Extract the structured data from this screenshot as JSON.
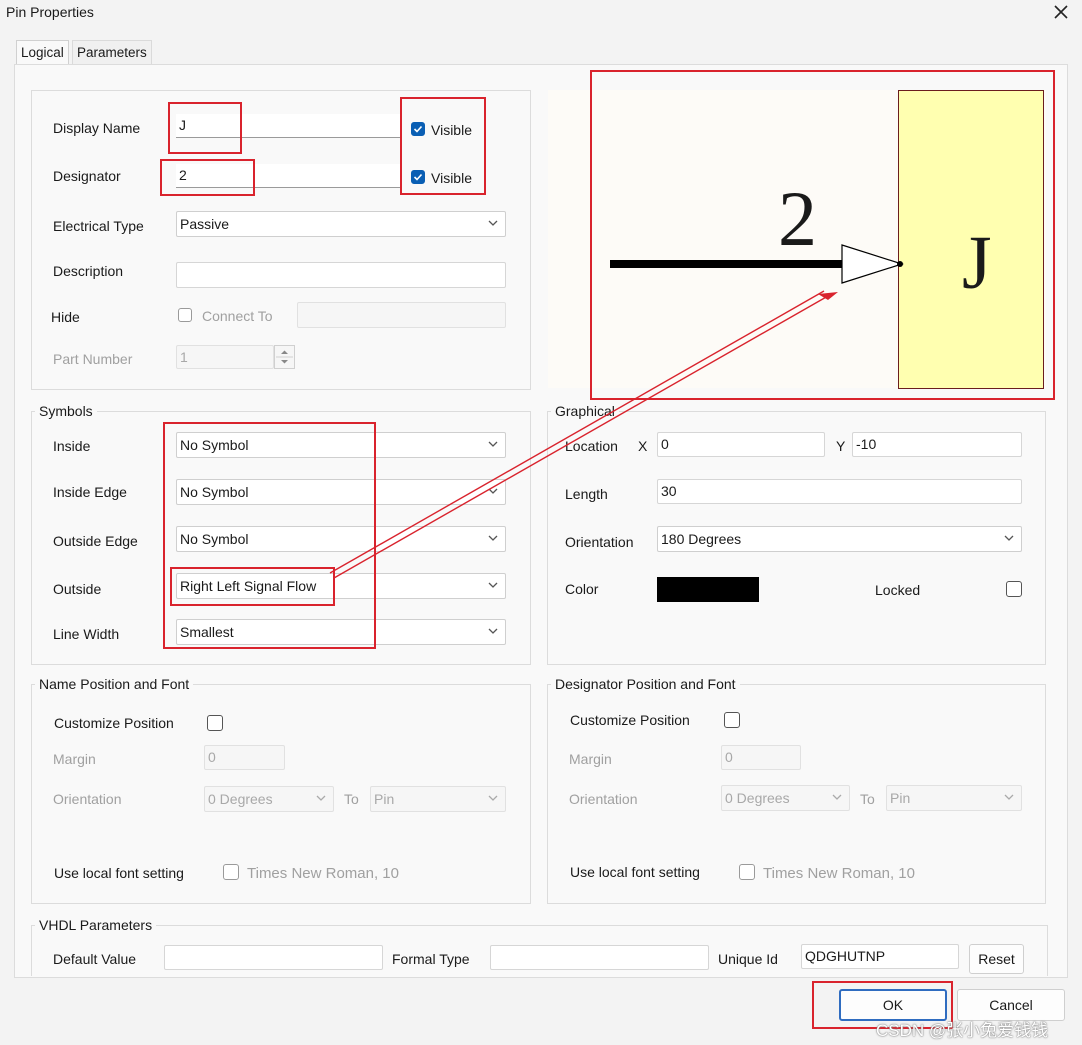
{
  "window": {
    "title": "Pin Properties"
  },
  "tabs": [
    {
      "label": "Logical"
    },
    {
      "label": "Parameters"
    }
  ],
  "logical": {
    "display_name_label": "Display Name",
    "display_name_value": "J",
    "designator_label": "Designator",
    "designator_value": "2",
    "visible_label": "Visible",
    "electrical_type_label": "Electrical Type",
    "electrical_type_value": "Passive",
    "description_label": "Description",
    "description_value": "",
    "hide_label": "Hide",
    "connect_to_label": "Connect To",
    "part_number_label": "Part Number",
    "part_number_value": "1"
  },
  "preview": {
    "designator_text": "2",
    "name_text": "J",
    "body_color": "#ffffb0"
  },
  "symbols": {
    "title": "Symbols",
    "inside_label": "Inside",
    "inside_value": "No Symbol",
    "inside_edge_label": "Inside Edge",
    "inside_edge_value": "No Symbol",
    "outside_edge_label": "Outside Edge",
    "outside_edge_value": "No Symbol",
    "outside_label": "Outside",
    "outside_value": "Right Left Signal Flow",
    "line_width_label": "Line Width",
    "line_width_value": "Smallest"
  },
  "graphical": {
    "title": "Graphical",
    "location_label": "Location",
    "x_label": "X",
    "x_value": "0",
    "y_label": "Y",
    "y_value": "-10",
    "length_label": "Length",
    "length_value": "30",
    "orientation_label": "Orientation",
    "orientation_value": "180 Degrees",
    "color_label": "Color",
    "color_value": "#000000",
    "locked_label": "Locked"
  },
  "name_pos": {
    "title": "Name Position and Font",
    "customize_label": "Customize Position",
    "margin_label": "Margin",
    "margin_value": "0",
    "orientation_label": "Orientation",
    "orientation_value": "0 Degrees",
    "to_label": "To",
    "to_value": "Pin",
    "font_label": "Use local font setting",
    "font_value": "Times New Roman, 10"
  },
  "des_pos": {
    "title": "Designator Position and Font",
    "customize_label": "Customize Position",
    "margin_label": "Margin",
    "margin_value": "0",
    "orientation_label": "Orientation",
    "orientation_value": "0 Degrees",
    "to_label": "To",
    "to_value": "Pin",
    "font_label": "Use local font setting",
    "font_value": "Times New Roman, 10"
  },
  "vhdl": {
    "title": "VHDL Parameters",
    "default_value_label": "Default Value",
    "default_value": "",
    "formal_type_label": "Formal Type",
    "formal_type": "",
    "unique_id_label": "Unique Id",
    "unique_id": "QDGHUTNP",
    "reset_label": "Reset"
  },
  "buttons": {
    "ok_label": "OK",
    "cancel_label": "Cancel"
  },
  "watermark": "CSDN @张小兔爱钱钱",
  "annotation_color": "#d9232d"
}
